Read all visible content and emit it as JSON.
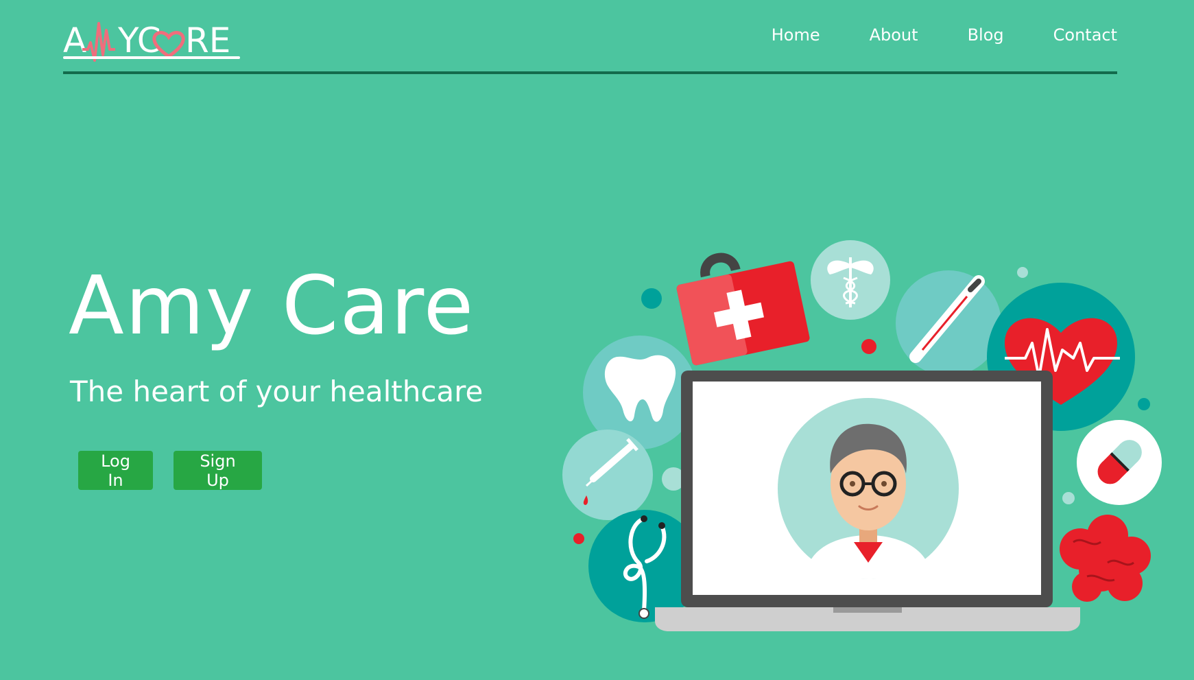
{
  "header": {
    "logo_text": "AMYCARE",
    "nav": [
      {
        "label": "Home"
      },
      {
        "label": "About"
      },
      {
        "label": "Blog"
      },
      {
        "label": "Contact"
      }
    ]
  },
  "hero": {
    "title": "Amy Care",
    "subtitle": "The heart of your healthcare",
    "login_label": "Log In",
    "signup_label": "Sign Up"
  },
  "illustration": {
    "items": [
      "first-aid-kit-icon",
      "caduceus-icon",
      "thermometer-icon",
      "heart-pulse-icon",
      "tooth-icon",
      "syringe-icon",
      "stethoscope-icon",
      "pill-icon",
      "brain-icon",
      "doctor-avatar",
      "laptop-icon"
    ]
  },
  "colors": {
    "background": "#4cc59f",
    "divider": "#136b4c",
    "button": "#27a744",
    "accent_red": "#e8202a",
    "accent_teal": "#00a19a"
  }
}
